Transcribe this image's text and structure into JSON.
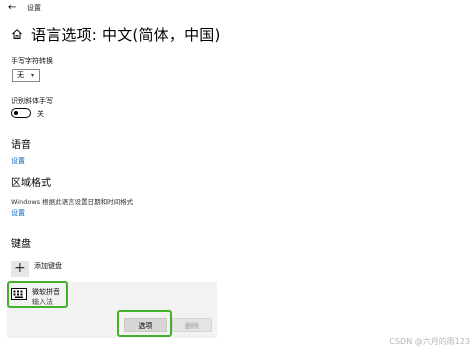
{
  "titlebar": {
    "back_glyph": "←",
    "app_name": "设置"
  },
  "header": {
    "title": "语言选项: 中文(简体，中国)",
    "home_icon": "home-icon"
  },
  "handwriting": {
    "convert_label": "手写字符转换",
    "convert_value": "无",
    "recognize_label": "识别斜体手写",
    "toggle_state": "关",
    "toggle_on": false
  },
  "speech": {
    "heading": "语音",
    "link": "设置"
  },
  "region": {
    "heading": "区域格式",
    "description": "Windows 根据此语言设置日期和时间格式",
    "link": "设置"
  },
  "keyboard": {
    "heading": "键盘",
    "add_label": "添加键盘",
    "add_glyph": "+",
    "ime_name": "微软拼音",
    "ime_type": "输入法",
    "options_button": "选项",
    "remove_button": "删除"
  },
  "watermark": "CSDN @六月的雨123",
  "colors": {
    "link": "#0067c0",
    "highlight": "#43b02a",
    "panel": "#f2f2f2"
  }
}
